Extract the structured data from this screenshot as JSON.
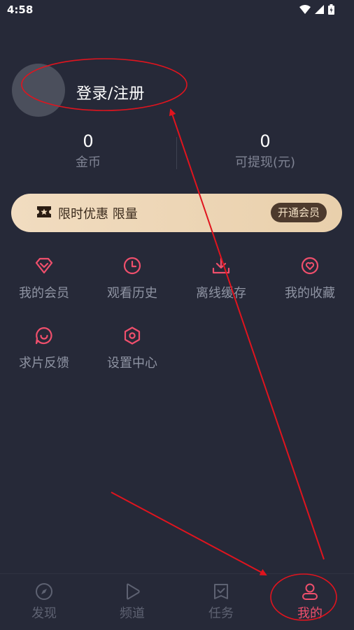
{
  "status_bar": {
    "time": "4:58"
  },
  "profile": {
    "login_label": "登录/注册"
  },
  "stats": [
    {
      "value": "0",
      "label": "金币"
    },
    {
      "value": "0",
      "label": "可提现(元)"
    }
  ],
  "vip_banner": {
    "text": "限时优惠 限量",
    "button_label": "开通会员"
  },
  "grid": [
    {
      "label": "我的会员",
      "icon": "diamond-icon"
    },
    {
      "label": "观看历史",
      "icon": "clock-icon"
    },
    {
      "label": "离线缓存",
      "icon": "download-icon"
    },
    {
      "label": "我的收藏",
      "icon": "heart-icon"
    },
    {
      "label": "求片反馈",
      "icon": "feedback-icon"
    },
    {
      "label": "设置中心",
      "icon": "settings-icon"
    }
  ],
  "tabs": [
    {
      "label": "发现",
      "icon": "compass-icon",
      "active": false
    },
    {
      "label": "频道",
      "icon": "play-icon",
      "active": false
    },
    {
      "label": "任务",
      "icon": "task-icon",
      "active": false
    },
    {
      "label": "我的",
      "icon": "user-icon",
      "active": true
    }
  ],
  "colors": {
    "background": "#262938",
    "accent": "#ef4f6c",
    "annotation": "#e0141e",
    "vip_gold": "#efd9bb"
  }
}
